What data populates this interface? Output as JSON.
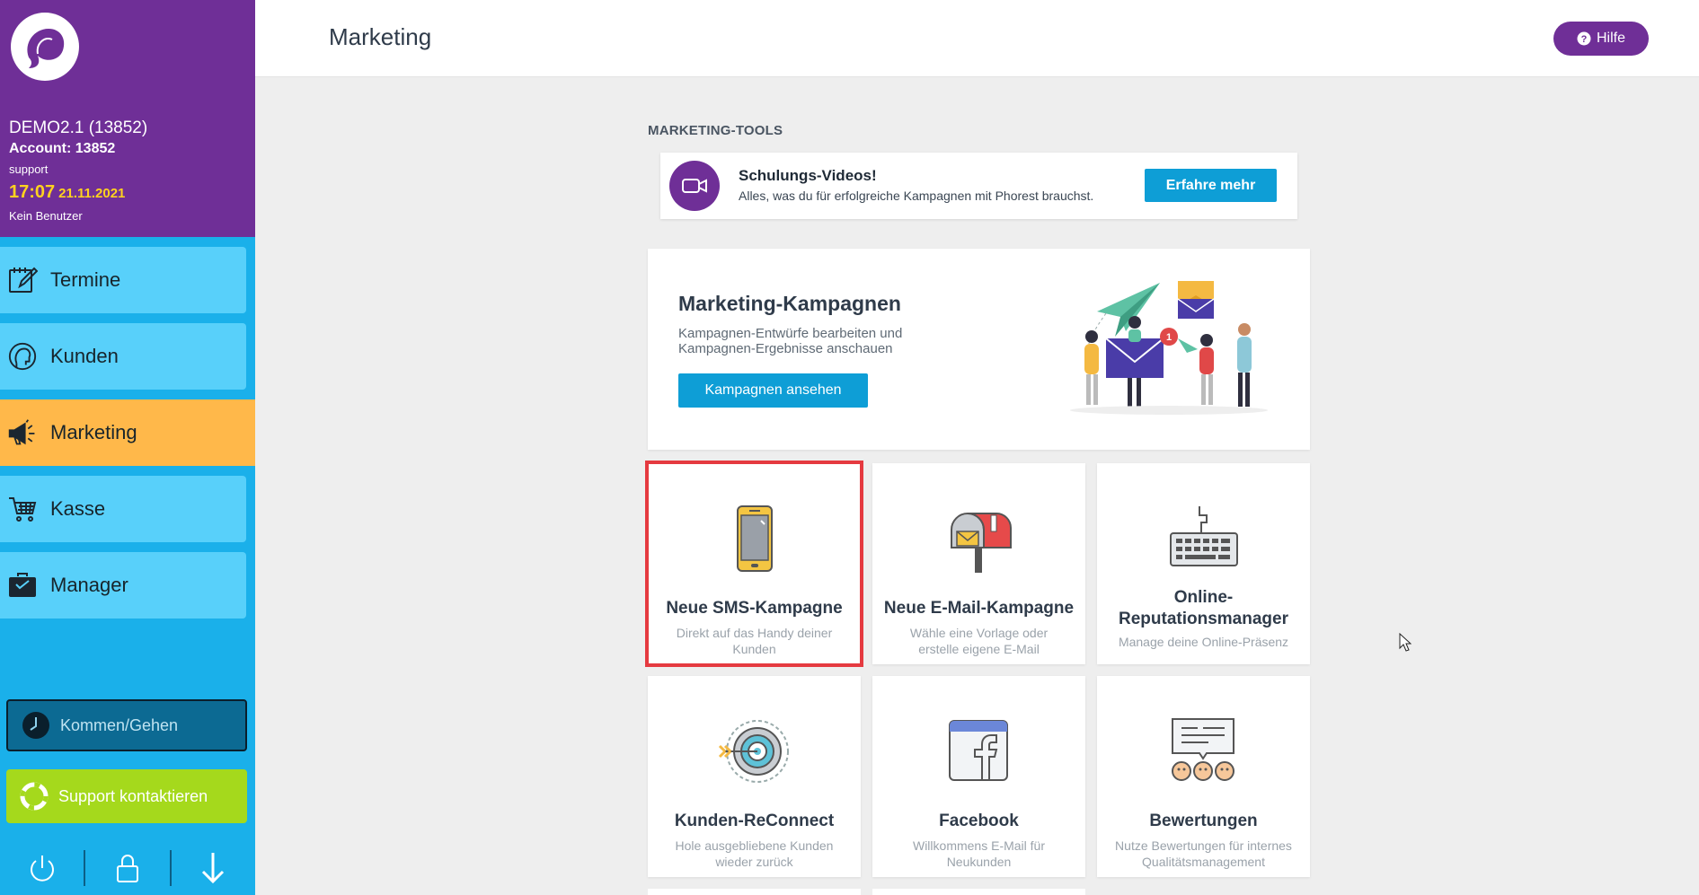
{
  "sidebar": {
    "org_name": "DEMO2.1 (13852)",
    "account": "Account: 13852",
    "role": "support",
    "time": "17:07",
    "date": "21.11.2021",
    "user_status": "Kein Benutzer",
    "items": [
      {
        "label": "Termine",
        "icon": "calendar-edit-icon"
      },
      {
        "label": "Kunden",
        "icon": "customer-head-icon"
      },
      {
        "label": "Marketing",
        "icon": "megaphone-icon"
      },
      {
        "label": "Kasse",
        "icon": "cart-icon"
      },
      {
        "label": "Manager",
        "icon": "briefcase-icon"
      }
    ],
    "clock_button": "Kommen/Gehen",
    "support_button": "Support kontaktieren",
    "active_color": "#ffb84a",
    "accent_color": "#6f2f97"
  },
  "header": {
    "title": "Marketing",
    "help_label": "Hilfe"
  },
  "tools": {
    "section_title": "MARKETING-TOOLS",
    "video": {
      "title": "Schulungs-Videos!",
      "subtitle": "Alles, was du für erfolgreiche Kampagnen mit Phorest brauchst.",
      "button": "Erfahre mehr"
    },
    "campaigns": {
      "title": "Marketing-Kampagnen",
      "description": "Kampagnen-Entwürfe bearbeiten und Kampagnen-Ergebnisse anschauen",
      "button": "Kampagnen ansehen"
    },
    "tiles": [
      {
        "title": "Neue SMS-Kampagne",
        "desc": "Direkt auf das Handy deiner Kunden"
      },
      {
        "title": "Neue E-Mail-Kampagne",
        "desc": "Wähle eine Vorlage oder erstelle eigene E-Mail"
      },
      {
        "title": "Online-Reputationsmanager",
        "desc": "Manage deine Online-Präsenz"
      },
      {
        "title": "Kunden-ReConnect",
        "desc": "Hole ausgebliebene Kunden wieder zurück"
      },
      {
        "title": "Facebook",
        "desc": "Willkommens E-Mail für Neukunden"
      },
      {
        "title": "Bewertungen",
        "desc": "Nutze Bewertungen für internes Qualitätsmanagement"
      }
    ]
  }
}
